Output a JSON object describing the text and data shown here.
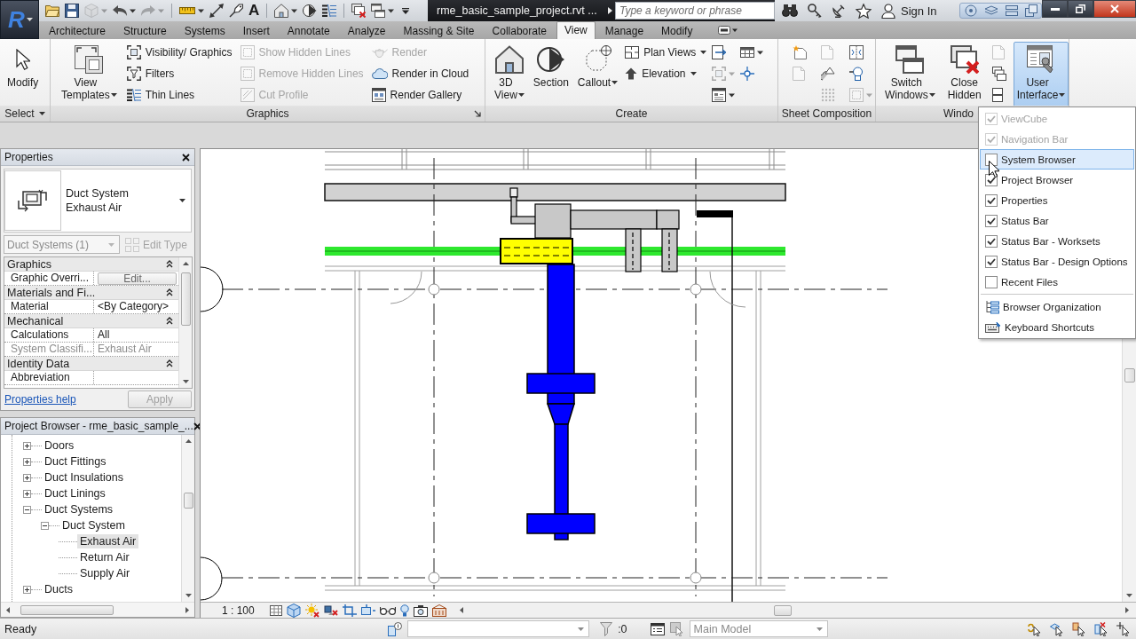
{
  "app_button": {
    "logo": "R"
  },
  "quick_access": [
    {
      "disabled": false,
      "menu": false
    },
    {
      "disabled": false,
      "menu": false
    },
    {
      "disabled": true,
      "menu": true
    },
    {
      "disabled": false,
      "menu": true
    },
    {
      "disabled": true,
      "menu": true
    },
    {
      "disabled": false,
      "menu": true
    },
    {
      "disabled": false,
      "menu": false
    },
    {
      "disabled": false,
      "menu": false
    },
    {
      "disabled": false,
      "menu": false,
      "glyph": "A"
    },
    {
      "disabled": false,
      "menu": true
    },
    {
      "disabled": false,
      "menu": false
    },
    {
      "disabled": false,
      "menu": false
    },
    {
      "disabled": false,
      "menu": false
    },
    {
      "disabled": false,
      "menu": true
    }
  ],
  "title_bar": {
    "document": "rme_basic_sample_project.rvt ...",
    "search": {
      "placeholder": "Type a keyword or phrase"
    },
    "sign_in": "Sign In"
  },
  "tabs": [
    {
      "label": "Architecture",
      "selected": false
    },
    {
      "label": "Structure",
      "selected": false
    },
    {
      "label": "Systems",
      "selected": false
    },
    {
      "label": "Insert",
      "selected": false
    },
    {
      "label": "Annotate",
      "selected": false
    },
    {
      "label": "Analyze",
      "selected": false
    },
    {
      "label": "Massing & Site",
      "selected": false
    },
    {
      "label": "Collaborate",
      "selected": false
    },
    {
      "label": "View",
      "selected": true
    },
    {
      "label": "Manage",
      "selected": false
    },
    {
      "label": "Modify",
      "selected": false
    }
  ],
  "ribbon": {
    "panels": [
      {
        "title": "Select",
        "menu": true,
        "launcher": false,
        "tools": [
          {
            "kind": "large",
            "label": "Modify",
            "menu": false,
            "disabled": false,
            "expanded": false
          }
        ]
      },
      {
        "title": "Graphics",
        "menu": false,
        "launcher": true,
        "tools": [
          {
            "kind": "large",
            "label": "View Templates",
            "menu": true,
            "disabled": false,
            "expanded": false
          },
          {
            "kind": "stack",
            "items": [
              {
                "label": "Visibility/ Graphics",
                "disabled": false,
                "menu": false
              },
              {
                "label": "Filters",
                "disabled": false,
                "menu": false
              },
              {
                "label": "Thin Lines",
                "disabled": false,
                "menu": false
              }
            ]
          },
          {
            "kind": "stack",
            "items": [
              {
                "label": "Show Hidden Lines",
                "disabled": true,
                "menu": false
              },
              {
                "label": "Remove Hidden Lines",
                "disabled": true,
                "menu": false
              },
              {
                "label": "Cut Profile",
                "disabled": true,
                "menu": false
              }
            ]
          },
          {
            "kind": "stack",
            "items": [
              {
                "label": "Render",
                "disabled": true,
                "menu": false
              },
              {
                "label": "Render in Cloud",
                "disabled": false,
                "menu": false
              },
              {
                "label": "Render Gallery",
                "disabled": false,
                "menu": false
              }
            ]
          }
        ]
      },
      {
        "title": "Create",
        "menu": false,
        "launcher": false,
        "tools": [
          {
            "kind": "large",
            "label": "3D View",
            "menu": true,
            "disabled": false,
            "expanded": false
          },
          {
            "kind": "large",
            "label": "Section",
            "menu": false,
            "disabled": false,
            "expanded": false
          },
          {
            "kind": "large",
            "label": "Callout",
            "menu": true,
            "disabled": false,
            "expanded": false
          },
          {
            "kind": "stack",
            "items": [
              {
                "label": "Plan Views",
                "disabled": false,
                "menu": true
              },
              {
                "label": "Elevation",
                "disabled": false,
                "menu": true
              }
            ]
          },
          {
            "kind": "stack",
            "items": [
              {
                "disabled": false,
                "menu": false
              },
              {
                "disabled": true,
                "menu": true
              },
              {
                "disabled": false,
                "menu": true
              }
            ]
          },
          {
            "kind": "stack",
            "items": [
              {
                "disabled": false,
                "menu": true
              },
              {
                "disabled": false,
                "menu": false
              }
            ]
          }
        ]
      },
      {
        "title": "Sheet Composition",
        "menu": false,
        "launcher": false,
        "tools": [
          {
            "kind": "stack",
            "items": [
              {
                "disabled": false,
                "menu": false
              },
              {
                "disabled": true,
                "menu": false
              }
            ]
          },
          {
            "kind": "stack",
            "items": [
              {
                "disabled": true,
                "menu": false
              },
              {
                "disabled": false,
                "menu": false
              },
              {
                "disabled": true,
                "menu": false
              }
            ]
          },
          {
            "kind": "stack",
            "items": [
              {
                "disabled": false,
                "menu": false
              },
              {
                "disabled": false,
                "menu": false
              },
              {
                "disabled": true,
                "menu": true
              }
            ]
          }
        ]
      },
      {
        "title": "Windo",
        "menu": false,
        "launcher": false,
        "tools": [
          {
            "kind": "large",
            "label": "Switch Windows",
            "menu": true,
            "disabled": false,
            "expanded": false
          },
          {
            "kind": "large",
            "label": "Close Hidden",
            "menu": false,
            "disabled": false,
            "expanded": false
          },
          {
            "kind": "stack",
            "items": [
              {
                "disabled": true,
                "menu": false
              },
              {
                "disabled": false,
                "menu": false
              },
              {
                "disabled": false,
                "menu": false
              }
            ]
          },
          {
            "kind": "large",
            "label": "User Interface",
            "menu": true,
            "disabled": false,
            "expanded": true
          }
        ]
      }
    ]
  },
  "properties": {
    "title": "Properties",
    "type": {
      "family": "Duct System",
      "name": "Exhaust Air"
    },
    "filter": {
      "value": "Duct Systems (1)",
      "disabled": true
    },
    "edit_type": {
      "label": "Edit Type",
      "disabled": true
    },
    "groups": [
      {
        "name": "Graphics",
        "expanded": true,
        "rows": [
          {
            "name": "Graphic Overri...",
            "kind": "button",
            "value": "Edit...",
            "disabled": false
          }
        ]
      },
      {
        "name": "Materials and Fi...",
        "expanded": true,
        "rows": [
          {
            "name": "Material",
            "kind": "text",
            "value": "<By Category>",
            "disabled": false
          }
        ]
      },
      {
        "name": "Mechanical",
        "expanded": true,
        "rows": [
          {
            "name": "Calculations",
            "kind": "text",
            "value": "All",
            "disabled": false
          },
          {
            "name": "System Classifi...",
            "kind": "text",
            "value": "Exhaust Air",
            "disabled": true
          }
        ]
      },
      {
        "name": "Identity Data",
        "expanded": true,
        "rows": [
          {
            "name": "Abbreviation",
            "kind": "text",
            "disabled": false
          }
        ]
      }
    ],
    "help": "Properties help",
    "apply": {
      "label": "Apply",
      "disabled": true
    }
  },
  "project_browser": {
    "title": "Project Browser - rme_basic_sample_...",
    "tree": [
      {
        "label": "Doors",
        "expanded": false,
        "selected": false
      },
      {
        "label": "Duct Fittings",
        "expanded": false,
        "selected": false
      },
      {
        "label": "Duct Insulations",
        "expanded": false,
        "selected": false
      },
      {
        "label": "Duct Linings",
        "expanded": false,
        "selected": false
      },
      {
        "label": "Duct Systems",
        "expanded": true,
        "selected": false,
        "children": [
          {
            "label": "Duct System",
            "expanded": true,
            "selected": false,
            "children": [
              {
                "label": "Exhaust Air",
                "selected": true
              },
              {
                "label": "Return Air",
                "selected": false
              },
              {
                "label": "Supply Air",
                "selected": false
              }
            ]
          }
        ]
      },
      {
        "label": "Ducts",
        "expanded": false,
        "selected": false
      }
    ]
  },
  "view_bar": {
    "scale": "1 : 100"
  },
  "status_bar": {
    "message": "Ready",
    "selection_count": ":0",
    "design_option": {
      "value": "Main Model",
      "disabled": true
    }
  },
  "ui_menu": {
    "items": [
      {
        "kind": "check",
        "label": "ViewCube",
        "checked": true,
        "disabled": true,
        "selected": false
      },
      {
        "kind": "check",
        "label": "Navigation Bar",
        "checked": true,
        "disabled": true,
        "selected": false
      },
      {
        "kind": "check",
        "label": "System Browser",
        "checked": false,
        "disabled": false,
        "selected": true
      },
      {
        "kind": "check",
        "label": "Project Browser",
        "checked": true,
        "disabled": false,
        "selected": false
      },
      {
        "kind": "check",
        "label": "Properties",
        "checked": true,
        "disabled": false,
        "selected": false
      },
      {
        "kind": "check",
        "label": "Status Bar",
        "checked": true,
        "disabled": false,
        "selected": false
      },
      {
        "kind": "check",
        "label": "Status Bar - Worksets",
        "checked": true,
        "disabled": false,
        "selected": false
      },
      {
        "kind": "check",
        "label": "Status Bar - Design Options",
        "checked": true,
        "disabled": false,
        "selected": false
      },
      {
        "kind": "check",
        "label": "Recent Files",
        "checked": false,
        "disabled": false,
        "selected": false
      },
      {
        "kind": "command",
        "label": "Browser Organization",
        "disabled": false,
        "selected": false
      },
      {
        "kind": "command",
        "label": "Keyboard Shortcuts",
        "disabled": false,
        "selected": false
      }
    ]
  }
}
